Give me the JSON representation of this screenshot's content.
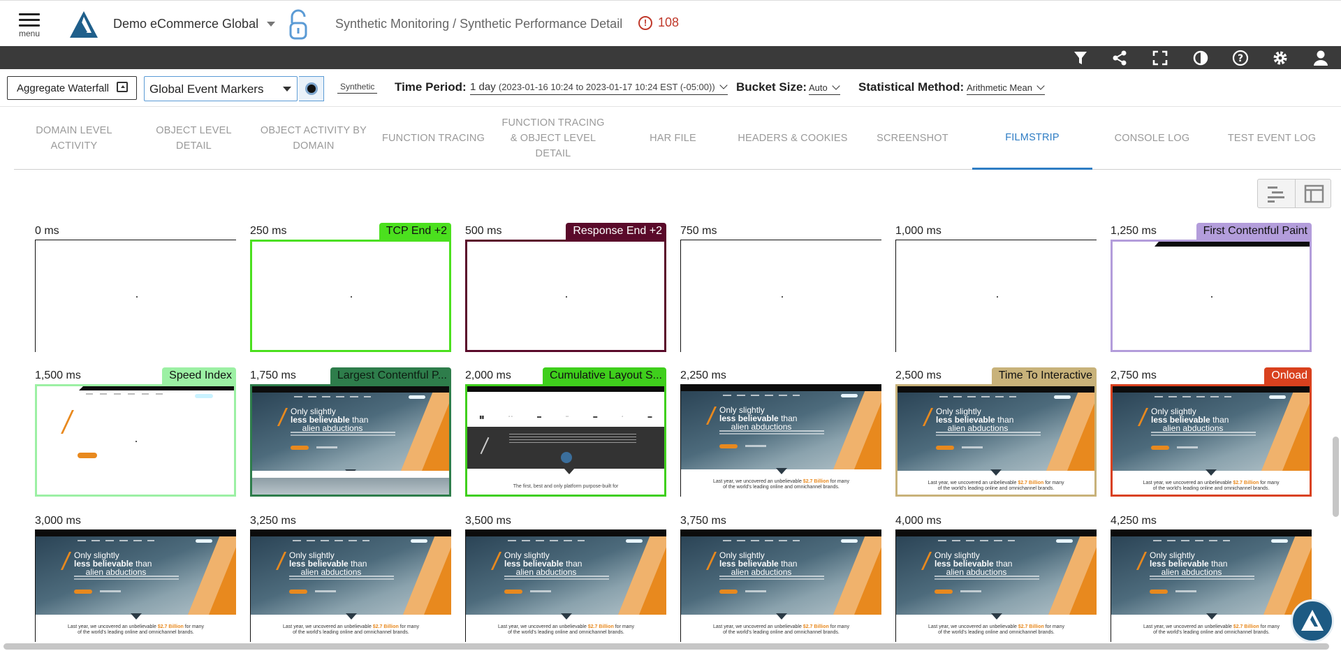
{
  "header": {
    "menu_label": "menu",
    "app_name": "Demo eCommerce Global",
    "breadcrumb": "Synthetic Monitoring / Synthetic Performance Detail",
    "alert_count": "108"
  },
  "toolbar": {
    "icons": [
      "filter-icon",
      "share-icon",
      "fullscreen-icon",
      "contrast-icon",
      "help-icon",
      "settings-icon",
      "user-icon"
    ]
  },
  "filters": {
    "aggregate_waterfall": "Aggregate Waterfall",
    "event_markers": "Global Event Markers",
    "synthetic_tag": "Synthetic",
    "time_period_label": "Time Period:",
    "time_period_value": "1 day",
    "time_period_range": "(2023-01-16 10:24 to 2023-01-17 10:24 EST (-05:00))",
    "bucket_size_label": "Bucket Size:",
    "bucket_size_value": "Auto",
    "stat_method_label": "Statistical Method:",
    "stat_method_value": "Arithmetic Mean"
  },
  "tabs": [
    {
      "label": "DOMAIN LEVEL ACTIVITY",
      "active": false
    },
    {
      "label": "OBJECT LEVEL DETAIL",
      "active": false
    },
    {
      "label": "OBJECT ACTIVITY BY DOMAIN",
      "active": false
    },
    {
      "label": "FUNCTION TRACING",
      "active": false
    },
    {
      "label": "FUNCTION TRACING & OBJECT LEVEL DETAIL",
      "active": false
    },
    {
      "label": "HAR FILE",
      "active": false
    },
    {
      "label": "HEADERS & COOKIES",
      "active": false
    },
    {
      "label": "SCREENSHOT",
      "active": false
    },
    {
      "label": "FILMSTRIP",
      "active": true
    },
    {
      "label": "CONSOLE LOG",
      "active": false
    },
    {
      "label": "TEST EVENT LOG",
      "active": false
    }
  ],
  "site_thumb": {
    "line1": "Only slightly",
    "line2_bold": "less believable",
    "line2_rest": " than",
    "line3": "alien abductions",
    "foot1_pre": "Last year, we uncovered an unbelievable ",
    "foot1_hl": "$2.7 Billion",
    "foot1_post": " for many",
    "foot2": "of the world's leading online and omnichannel brands.",
    "promo_text": "The first, best and only platform purpose-built for"
  },
  "frames": [
    {
      "time": "0 ms",
      "marker": "",
      "marker_color": "",
      "content": "blank"
    },
    {
      "time": "250 ms",
      "marker": "TCP End +2",
      "marker_color": "#4be01e",
      "content": "blank"
    },
    {
      "time": "500 ms",
      "marker": "Response End +2",
      "marker_color": "#5a0a2a",
      "content": "blank"
    },
    {
      "time": "750 ms",
      "marker": "",
      "marker_color": "",
      "content": "blank"
    },
    {
      "time": "1,000 ms",
      "marker": "",
      "marker_color": "",
      "content": "blank"
    },
    {
      "time": "1,250 ms",
      "marker": "First Contentful Paint",
      "marker_color": "#b39ddb",
      "content": "navbar"
    },
    {
      "time": "1,500 ms",
      "marker": "Speed Index",
      "marker_color": "#9cf0a4",
      "content": "partial"
    },
    {
      "time": "1,750 ms",
      "marker": "Largest Contentful P...",
      "marker_color": "#2e7d4b",
      "content": "hero-scroll"
    },
    {
      "time": "2,000 ms",
      "marker": "Cumulative Layout S...",
      "marker_color": "#3fcf1c",
      "content": "logos"
    },
    {
      "time": "2,250 ms",
      "marker": "",
      "marker_color": "",
      "content": "site"
    },
    {
      "time": "2,500 ms",
      "marker": "Time To Interactive",
      "marker_color": "#c8b27a",
      "content": "site"
    },
    {
      "time": "2,750 ms",
      "marker": "Onload",
      "marker_color": "#d9411e",
      "content": "site"
    },
    {
      "time": "3,000 ms",
      "marker": "",
      "marker_color": "",
      "content": "site"
    },
    {
      "time": "3,250 ms",
      "marker": "",
      "marker_color": "",
      "content": "site"
    },
    {
      "time": "3,500 ms",
      "marker": "",
      "marker_color": "",
      "content": "site"
    },
    {
      "time": "3,750 ms",
      "marker": "",
      "marker_color": "",
      "content": "site"
    },
    {
      "time": "4,000 ms",
      "marker": "",
      "marker_color": "",
      "content": "site"
    },
    {
      "time": "4,250 ms",
      "marker": "",
      "marker_color": "",
      "content": "site"
    }
  ]
}
